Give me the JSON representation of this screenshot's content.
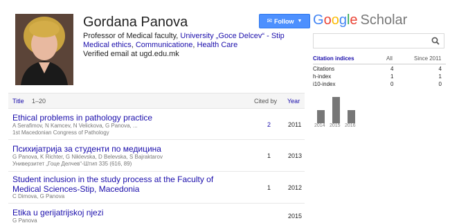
{
  "profile": {
    "name": "Gordana Panova",
    "follow_label": "Follow",
    "affiliation_prefix": "Professor of Medical faculty, ",
    "affiliation_link": "University „Goce Delcev“ - Stip",
    "interests": [
      "Medical ethics",
      "Communicatione",
      "Health Care"
    ],
    "interest_separator": ", ",
    "verified": "Verified email at ugd.edu.mk"
  },
  "table": {
    "title_label": "Title",
    "range": "1–20",
    "cited_label": "Cited by",
    "year_label": "Year"
  },
  "articles": [
    {
      "title": "Ethical problems in pathology practice",
      "authors": "A Serafimov, N Kamcev, N Velickova, G Panova, ...",
      "venue": "1st Macedonian Congress of Pathology",
      "cited": "2",
      "year": "2011"
    },
    {
      "title": "Психијатрија за студенти по медицина",
      "authors": "G Panova, K Richter, G Niklevska, D Belevska, S Bajraktarov",
      "venue": "Универзитет „Гоце Делчев“-Штип 335 (616, 89)",
      "cited": "1",
      "year": "2013"
    },
    {
      "title": "Student inclusion in the study process at the Faculty of Medical Sciences-Stip, Macedonia",
      "authors": "C Dimova, G Panova",
      "venue": "",
      "cited": "1",
      "year": "2012"
    },
    {
      "title": "Etika u gerijatrijskoj njezi",
      "authors": "G Panova",
      "venue": "",
      "cited": "",
      "year": "2015"
    }
  ],
  "scholar": {
    "logo_letters": [
      "G",
      "o",
      "o",
      "g",
      "l",
      "e"
    ],
    "logo_suffix": "Scholar",
    "search_placeholder": "",
    "citation_indices_label": "Citation indices",
    "col_all": "All",
    "col_since": "Since 2011",
    "indices": [
      {
        "label": "Citations",
        "all": "4",
        "since": "4"
      },
      {
        "label": "h-index",
        "all": "1",
        "since": "1"
      },
      {
        "label": "i10-index",
        "all": "0",
        "since": "0"
      }
    ]
  },
  "chart_data": {
    "type": "bar",
    "categories": [
      "2014",
      "2015",
      "2016"
    ],
    "values": [
      1,
      2,
      1
    ],
    "title": "",
    "xlabel": "",
    "ylabel": "",
    "ylim": [
      0,
      2
    ],
    "color": "#777777"
  },
  "colors": {
    "link": "#1a0dab",
    "follow_button": "#4d90fe"
  }
}
